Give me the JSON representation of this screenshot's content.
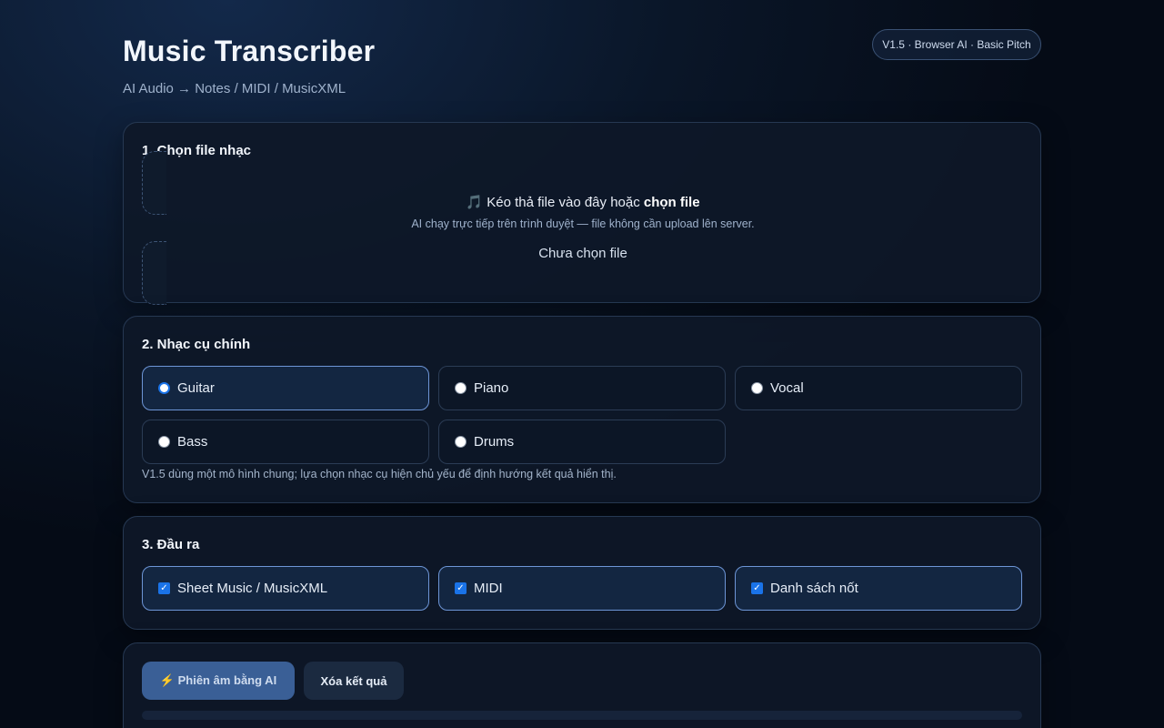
{
  "header": {
    "title": "Music Transcriber",
    "subtitle": "AI Audio → Notes / MIDI / MusicXML",
    "version_badge": "V1.5 · Browser AI · Basic Pitch"
  },
  "section_file": {
    "title": "1. Chọn file nhạc",
    "dropzone_prefix": "🎵 Kéo thả file vào đây hoặc ",
    "dropzone_link": "chọn file",
    "hint": "AI chạy trực tiếp trên trình duyệt — file không cần upload lên server.",
    "status": "Chưa chọn file"
  },
  "section_instrument": {
    "title": "2. Nhạc cụ chính",
    "options": [
      {
        "label": "Guitar",
        "selected": true
      },
      {
        "label": "Piano",
        "selected": false
      },
      {
        "label": "Vocal",
        "selected": false
      },
      {
        "label": "Bass",
        "selected": false
      },
      {
        "label": "Drums",
        "selected": false
      }
    ],
    "note": "V1.5 dùng một mô hình chung; lựa chọn nhạc cụ hiện chủ yếu để định hướng kết quả hiển thị."
  },
  "section_output": {
    "title": "3. Đầu ra",
    "options": [
      {
        "label": "Sheet Music / MusicXML",
        "checked": true
      },
      {
        "label": "MIDI",
        "checked": true
      },
      {
        "label": "Danh sách nốt",
        "checked": true
      }
    ]
  },
  "actions": {
    "transcribe_label": "⚡ Phiên âm bằng AI",
    "clear_label": "Xóa kết quả",
    "progress": 0
  },
  "colors": {
    "accent": "#1a73e8",
    "selected_border": "#6d95d6",
    "primary_button": "#3a5f96"
  }
}
